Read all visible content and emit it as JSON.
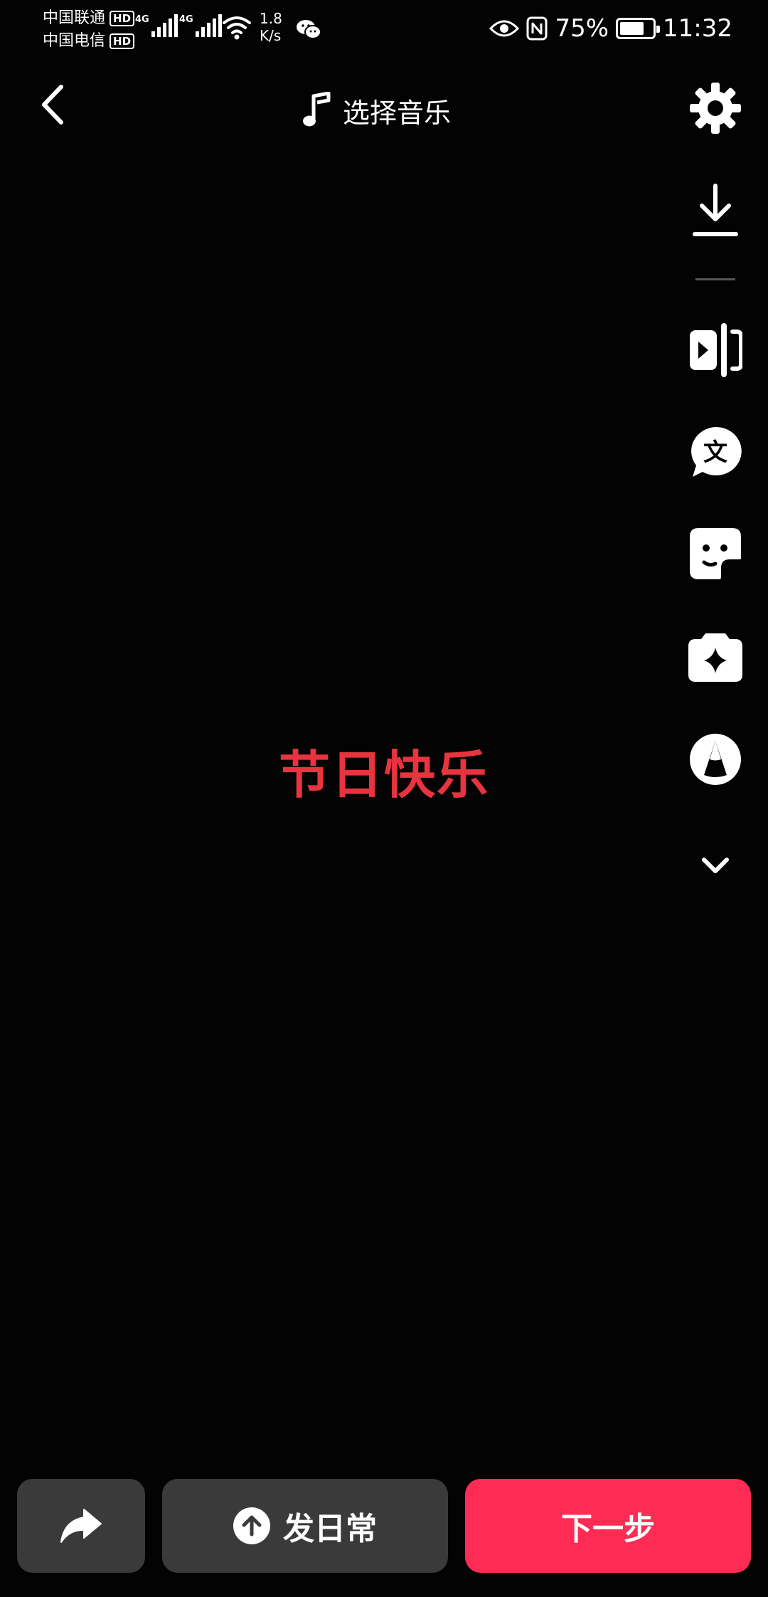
{
  "status_bar": {
    "carrier_1": "中国联通",
    "carrier_2": "中国电信",
    "hd_badge": "HD",
    "network_tag": "4G",
    "speed_value": "1.8",
    "speed_unit": "K/s",
    "battery": "75%",
    "battery_level": 0.75,
    "time": "11:32",
    "icons": [
      "signal-icon",
      "wifi-icon",
      "wechat-icon",
      "eye-icon",
      "nfc-icon",
      "battery-icon"
    ]
  },
  "header": {
    "back_icon": "chevron-left-icon",
    "music_icon": "music-note-icon",
    "music_label": "选择音乐"
  },
  "toolbar": {
    "items": [
      {
        "name": "settings",
        "icon": "gear-icon"
      },
      {
        "name": "download",
        "icon": "download-icon"
      },
      {
        "name": "clip",
        "icon": "video-trim-icon"
      },
      {
        "name": "text",
        "icon": "text-bubble-icon",
        "glyph": "文"
      },
      {
        "name": "sticker",
        "icon": "sticker-icon"
      },
      {
        "name": "effects",
        "icon": "sparkle-icon"
      },
      {
        "name": "filter",
        "icon": "filter-icon"
      },
      {
        "name": "more",
        "icon": "chevron-down-icon"
      }
    ]
  },
  "canvas": {
    "text": "节日快乐",
    "text_color": "#e8343f",
    "background": "#030303"
  },
  "bottom_bar": {
    "share_icon": "share-arrow-icon",
    "daily_icon": "upload-arrow-icon",
    "daily_label": "发日常",
    "next_label": "下一步",
    "next_color": "#fe2c55",
    "secondary_color": "#3a3a3a"
  }
}
